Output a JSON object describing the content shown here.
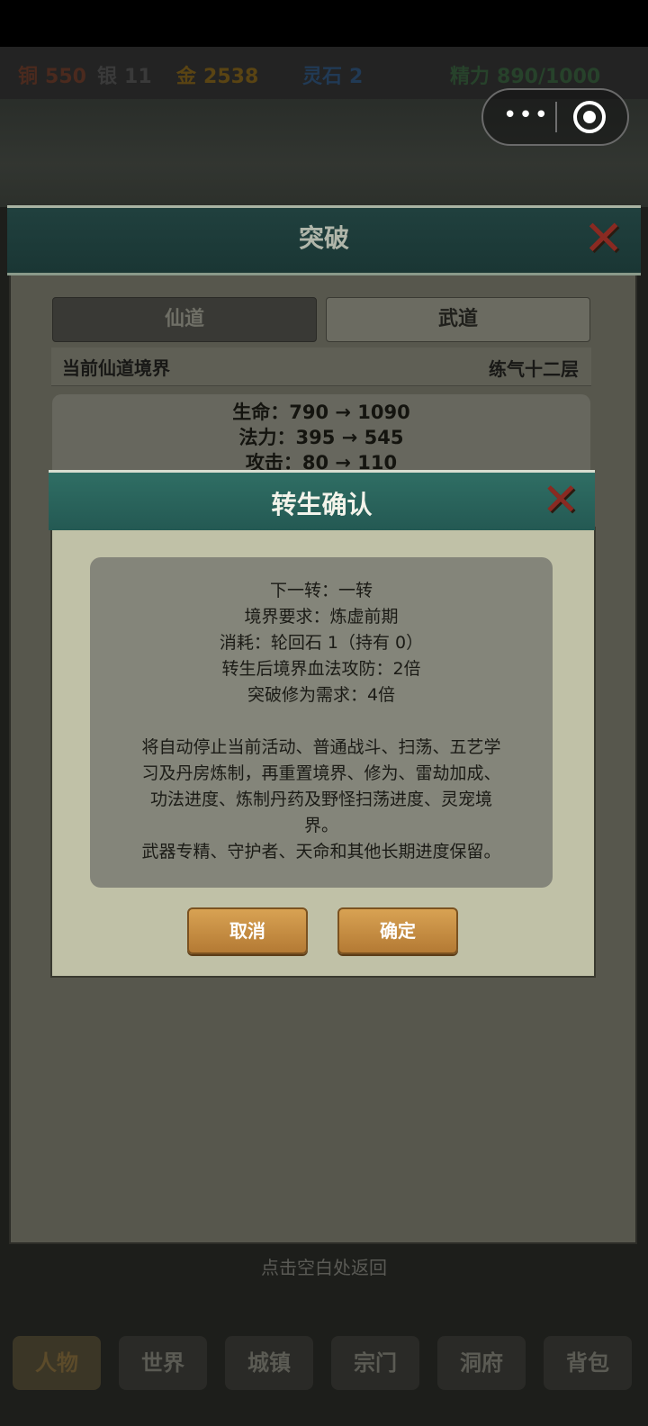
{
  "resources": [
    {
      "label": "铜",
      "value": "550",
      "color": "#4b2a1e"
    },
    {
      "label": "银",
      "value": "11",
      "color": "#3a3a3a"
    },
    {
      "label": "金",
      "value": "2538",
      "color": "#5a4413"
    },
    {
      "label": "灵石",
      "value": "2",
      "color": "#213a55"
    },
    {
      "label": "精力",
      "value": "890/1000",
      "color": "#27422b"
    }
  ],
  "capsule": {
    "menu_icon": "more-dots-icon",
    "close_icon": "target-close-icon"
  },
  "breakthrough": {
    "title": "突破",
    "tabs": [
      {
        "label": "仙道",
        "active": true
      },
      {
        "label": "武道",
        "active": false
      }
    ],
    "realm_label": "当前仙道境界",
    "realm_value": "练气十二层",
    "stats": [
      "生命：790 → 1090",
      "法力：395 → 545",
      "攻击：80 → 110"
    ]
  },
  "dialog": {
    "title": "转生确认",
    "lines": [
      "下一转：一转",
      "境界要求：炼虚前期",
      "消耗：轮回石 1（持有 0）",
      "转生后境界血法攻防：2倍",
      "突破修为需求：4倍",
      "",
      "将自动停止当前活动、普通战斗、扫荡、五艺学",
      "习及丹房炼制，再重置境界、修为、雷劫加成、",
      "功法进度、炼制丹药及野怪扫荡进度、灵宠境",
      "界。",
      "武器专精、守护者、天命和其他长期进度保留。"
    ],
    "cancel": "取消",
    "confirm": "确定"
  },
  "hint": "点击空白处返回",
  "nav": [
    "人物",
    "世界",
    "城镇",
    "宗门",
    "洞府",
    "背包"
  ]
}
